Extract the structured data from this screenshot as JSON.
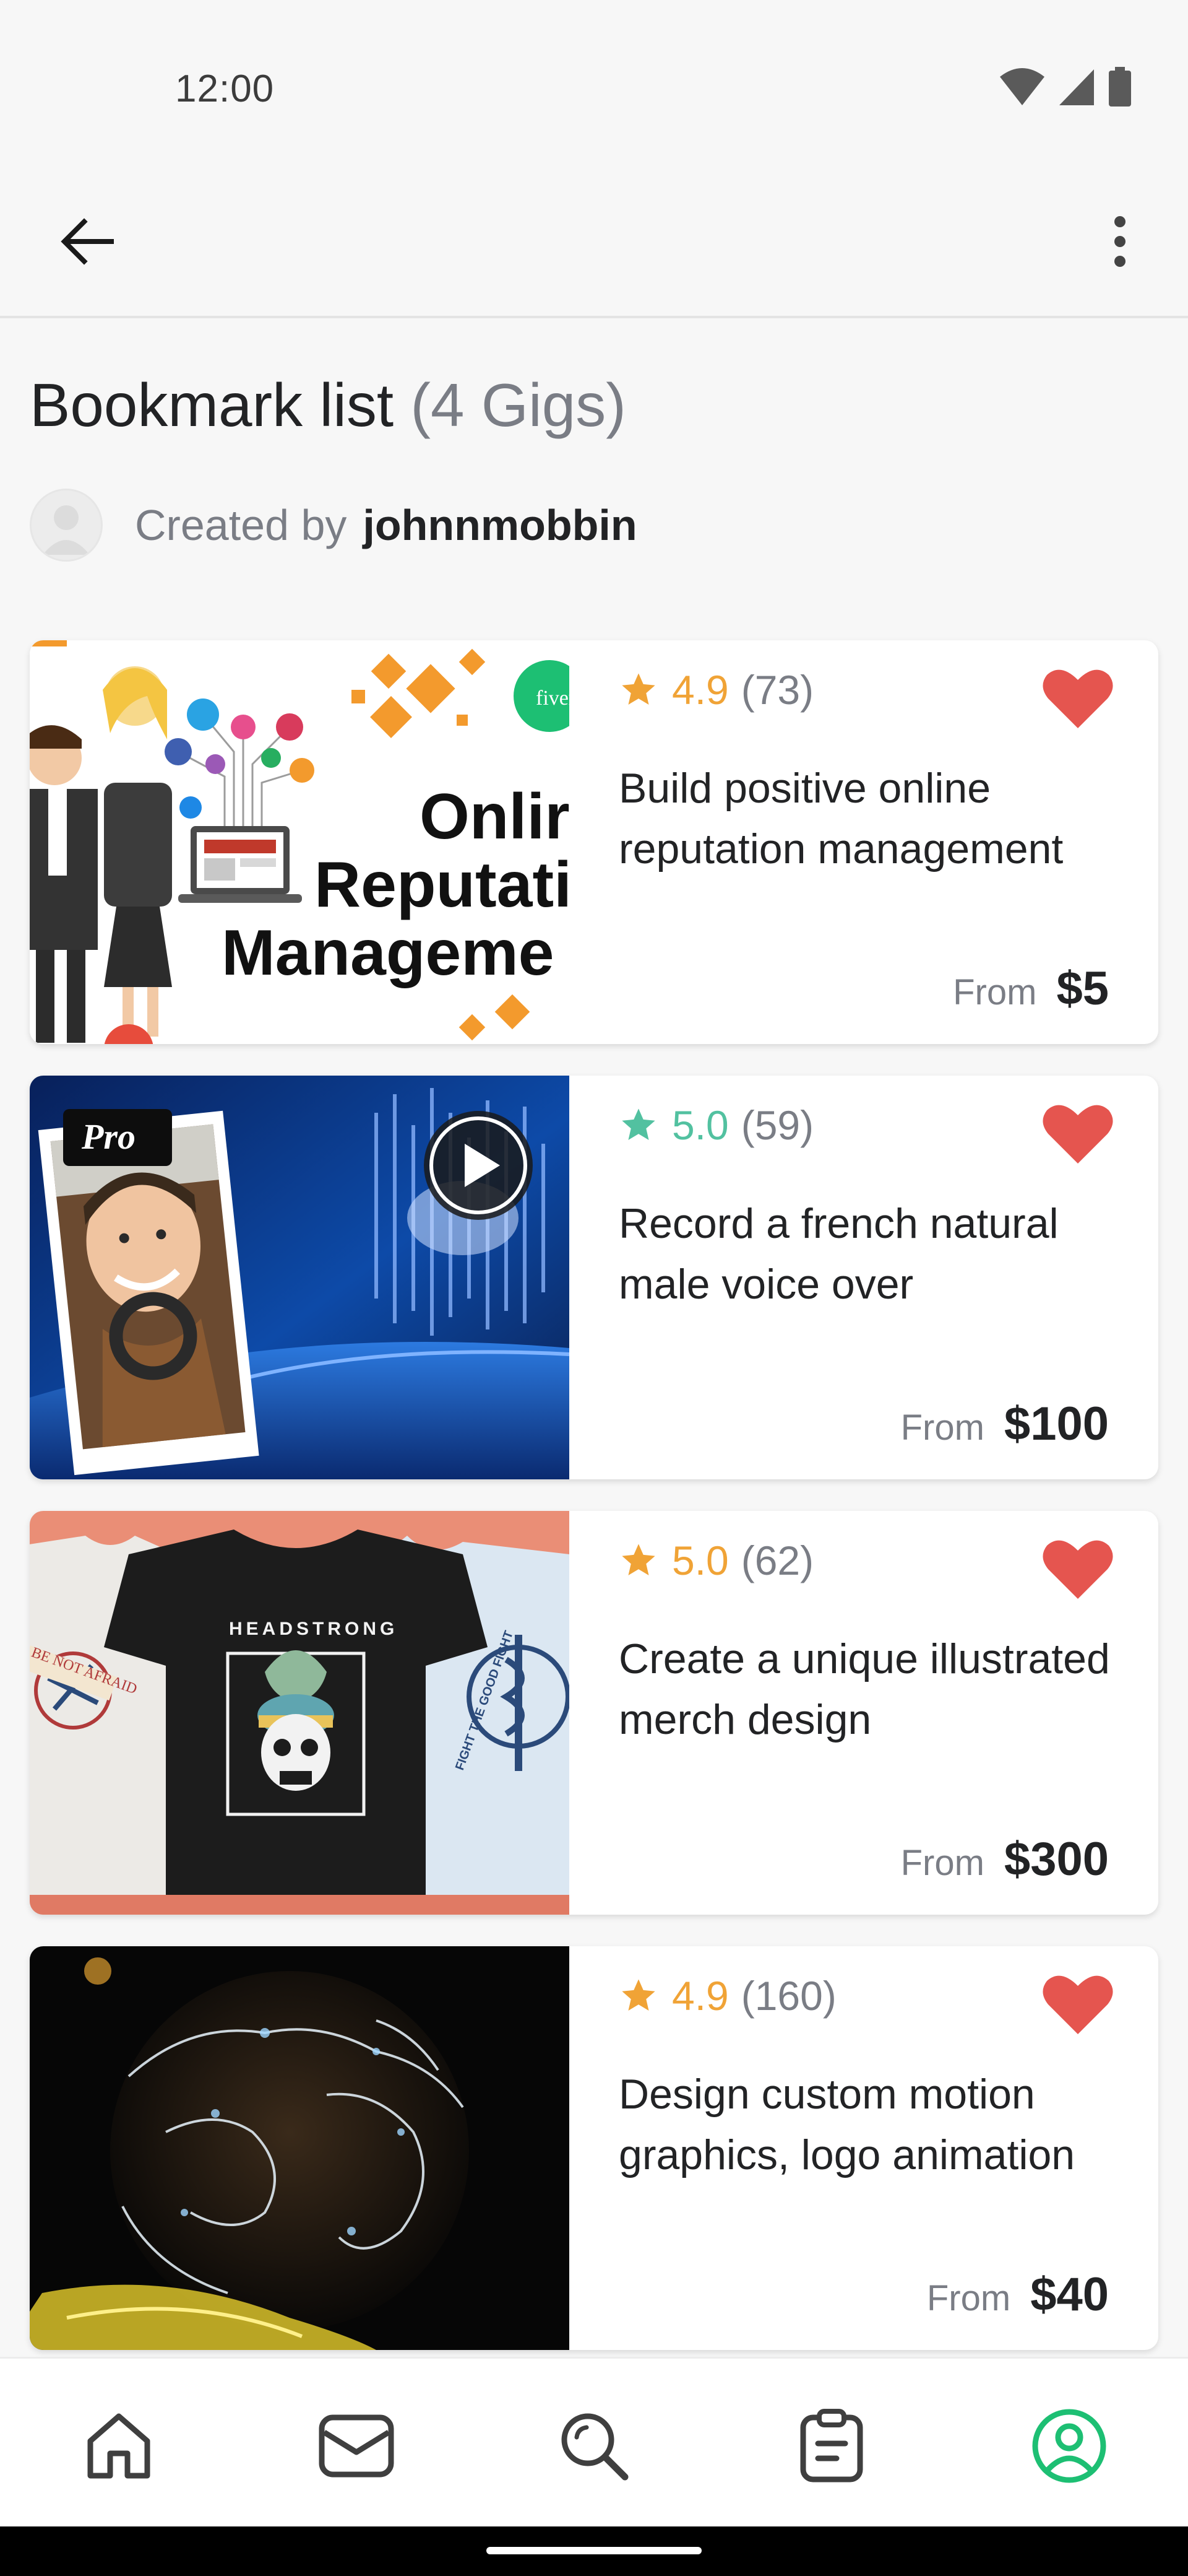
{
  "status_bar": {
    "time": "12:00"
  },
  "header": {
    "title": "Bookmark list",
    "count_label": "(4 Gigs)",
    "created_by_prefix": "Created by",
    "creator_username": "johnnmobbin"
  },
  "gigs": [
    {
      "rating": "4.9",
      "reviews": "(73)",
      "title": "Build positive online reputation management",
      "from_label": "From",
      "price": "$5",
      "rating_color": "#f0a336",
      "image": "online-reputation-illustration",
      "image_text": {
        "badge": "fiverr",
        "line1": "Onlir",
        "line2": "Reputatic",
        "line3": "Manageme"
      }
    },
    {
      "rating": "5.0",
      "reviews": "(59)",
      "title": "Record a french natural male voice over",
      "from_label": "From",
      "price": "$100",
      "rating_color": "#52c1a0",
      "image": "voice-over-portrait",
      "image_text": {
        "badge": "Pro"
      }
    },
    {
      "rating": "5.0",
      "reviews": "(62)",
      "title": "Create a unique illustrated merch design",
      "from_label": "From",
      "price": "$300",
      "rating_color": "#f0a336",
      "image": "tshirt-designs",
      "image_text": {
        "shirt_center": "HEADSTRONG",
        "shirt_left": "BE NOT AFRAID",
        "shirt_right": "FIGHT THE GOOD FIGHT"
      }
    },
    {
      "rating": "4.9",
      "reviews": "(160)",
      "title": "Design custom motion graphics, logo animation",
      "from_label": "From",
      "price": "$40",
      "rating_color": "#f0a336",
      "image": "glowing-globe"
    }
  ],
  "bottom_nav": [
    {
      "name": "home",
      "icon": "home-icon",
      "active": false
    },
    {
      "name": "inbox",
      "icon": "mail-icon",
      "active": false
    },
    {
      "name": "search",
      "icon": "search-icon",
      "active": false
    },
    {
      "name": "orders",
      "icon": "clipboard-icon",
      "active": false
    },
    {
      "name": "profile",
      "icon": "profile-icon",
      "active": true
    }
  ],
  "colors": {
    "accent_green": "#1dbf73",
    "heart_red": "#e5554f",
    "rating_orange": "#f0a336",
    "rating_teal": "#52c1a0"
  }
}
